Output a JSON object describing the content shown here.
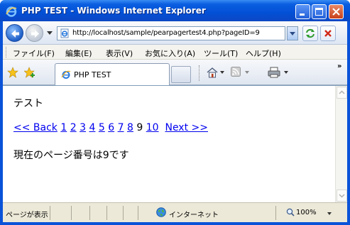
{
  "window": {
    "title": "PHP TEST - Windows Internet Explorer"
  },
  "address": {
    "url": "http://localhost/sample/pearpagertest4.php?pageID=9"
  },
  "menu": {
    "items": [
      "ファイル(F)",
      "編集(E)",
      "表示(V)",
      "お気に入り(A)",
      "ツール(T)",
      "ヘルプ(H)"
    ]
  },
  "tab": {
    "label": "PHP TEST"
  },
  "page": {
    "heading_text": "テスト",
    "pager": {
      "back": "<< Back",
      "pages": [
        "1",
        "2",
        "3",
        "4",
        "5",
        "6",
        "7",
        "8",
        "9",
        "10"
      ],
      "current_page": "9",
      "next": "Next >>"
    },
    "message": "現在のページ番号は9です"
  },
  "status": {
    "left_text": "ページが表示",
    "zone": "インターネット",
    "zoom": "100%"
  },
  "colors": {
    "link": "#0000ee",
    "titlebar": "#0350d6"
  }
}
